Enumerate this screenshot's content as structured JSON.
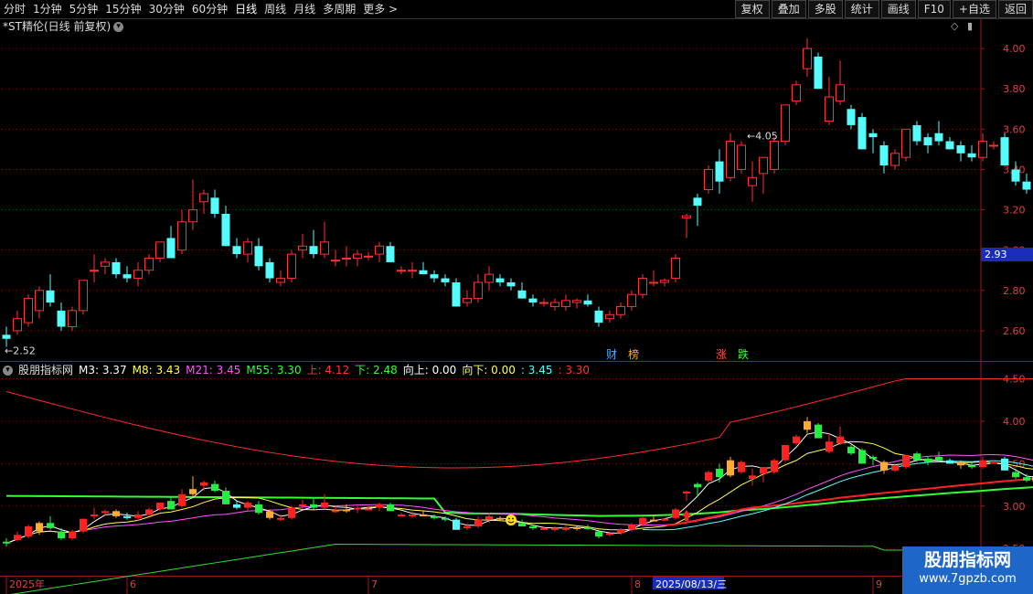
{
  "toolbar": {
    "periods": [
      "分时",
      "1分钟",
      "5分钟",
      "15分钟",
      "30分钟",
      "60分钟",
      "日线",
      "周线",
      "月线",
      "多周期",
      "更多 >"
    ],
    "active_period": "日线",
    "buttons": [
      "复权",
      "叠加",
      "多股",
      "统计",
      "画线",
      "F10",
      "+自选",
      "返回"
    ]
  },
  "stock_title": "*ST精伦(日线 前复权)",
  "current_price_tag": "2.93",
  "indicator": {
    "name": "股朋指标网",
    "items": [
      {
        "label": "M3: 3.37",
        "color": "#ffffff"
      },
      {
        "label": "M8: 3.43",
        "color": "#ffff55"
      },
      {
        "label": "M21: 3.45",
        "color": "#ff55ff"
      },
      {
        "label": "M55: 3.30",
        "color": "#33ff33"
      },
      {
        "label": "上: 4.12",
        "color": "#ff3333"
      },
      {
        "label": "下: 2.48",
        "color": "#33ff33"
      },
      {
        "label": "向上: 0.00",
        "color": "#ffffff"
      },
      {
        "label": "向下: 0.00",
        "color": "#ffff55"
      },
      {
        "label": ": 3.45",
        "color": "#55ffff"
      },
      {
        "label": ": 3.30",
        "color": "#ff3333"
      }
    ]
  },
  "watermark": {
    "line1": "股朋指标网",
    "line2": "www.7gpzb.com"
  },
  "colors": {
    "up": "#ff3333",
    "down": "#54fcfc",
    "background": "#000000",
    "grid": "#7a1010",
    "axis": "#a01818"
  },
  "markers": [
    {
      "text": "财",
      "color": "#55aaff",
      "index": 55
    },
    {
      "text": "榜",
      "color": "#ffaa33",
      "index": 57
    },
    {
      "text": "涨",
      "color": "#ff5555",
      "index": 65
    },
    {
      "text": "跌",
      "color": "#33ff33",
      "index": 67
    }
  ],
  "chart_data": [
    {
      "type": "candlestick",
      "title": "*ST精伦(日线 前复权)",
      "ylim": [
        2.45,
        4.15
      ],
      "yticks": [
        2.6,
        2.8,
        3.0,
        3.2,
        3.4,
        3.6,
        3.8,
        4.0
      ],
      "annotations": [
        {
          "text": "2.52",
          "type": "low",
          "index": 0
        },
        {
          "text": "4.05",
          "type": "high",
          "index": 67
        }
      ],
      "ohlc": [
        [
          2.58,
          2.62,
          2.52,
          2.56
        ],
        [
          2.6,
          2.7,
          2.58,
          2.66
        ],
        [
          2.64,
          2.78,
          2.62,
          2.76
        ],
        [
          2.7,
          2.82,
          2.66,
          2.8
        ],
        [
          2.8,
          2.88,
          2.72,
          2.74
        ],
        [
          2.7,
          2.74,
          2.6,
          2.62
        ],
        [
          2.62,
          2.72,
          2.6,
          2.7
        ],
        [
          2.7,
          2.85,
          2.68,
          2.85
        ],
        [
          2.9,
          2.98,
          2.84,
          2.9
        ],
        [
          2.92,
          2.96,
          2.88,
          2.94
        ],
        [
          2.94,
          2.96,
          2.86,
          2.88
        ],
        [
          2.88,
          2.92,
          2.84,
          2.86
        ],
        [
          2.86,
          2.94,
          2.82,
          2.9
        ],
        [
          2.9,
          2.98,
          2.88,
          2.96
        ],
        [
          2.96,
          3.04,
          2.94,
          3.04
        ],
        [
          3.06,
          3.12,
          2.96,
          2.96
        ],
        [
          3.0,
          3.2,
          2.98,
          3.14
        ],
        [
          3.14,
          3.35,
          3.1,
          3.2
        ],
        [
          3.24,
          3.3,
          3.18,
          3.28
        ],
        [
          3.26,
          3.3,
          3.16,
          3.18
        ],
        [
          3.18,
          3.22,
          3.02,
          3.02
        ],
        [
          3.02,
          3.06,
          2.96,
          2.98
        ],
        [
          2.98,
          3.06,
          2.94,
          3.04
        ],
        [
          3.02,
          3.06,
          2.9,
          2.92
        ],
        [
          2.94,
          2.96,
          2.84,
          2.86
        ],
        [
          2.84,
          2.9,
          2.82,
          2.86
        ],
        [
          2.86,
          3.0,
          2.84,
          2.98
        ],
        [
          3.0,
          3.08,
          2.96,
          3.02
        ],
        [
          3.02,
          3.1,
          2.96,
          2.98
        ],
        [
          2.98,
          3.14,
          2.96,
          3.04
        ],
        [
          2.95,
          3.0,
          2.92,
          2.95
        ],
        [
          2.96,
          3.02,
          2.92,
          2.96
        ],
        [
          2.96,
          3.0,
          2.92,
          2.98
        ],
        [
          2.97,
          2.99,
          2.95,
          2.97
        ],
        [
          2.98,
          3.04,
          2.94,
          3.02
        ],
        [
          3.02,
          3.04,
          2.94,
          2.94
        ],
        [
          2.9,
          2.92,
          2.88,
          2.9
        ],
        [
          2.9,
          2.94,
          2.86,
          2.9
        ],
        [
          2.9,
          2.94,
          2.88,
          2.88
        ],
        [
          2.88,
          2.9,
          2.84,
          2.86
        ],
        [
          2.86,
          2.88,
          2.82,
          2.84
        ],
        [
          2.84,
          2.86,
          2.72,
          2.72
        ],
        [
          2.74,
          2.8,
          2.72,
          2.76
        ],
        [
          2.76,
          2.88,
          2.74,
          2.84
        ],
        [
          2.84,
          2.92,
          2.8,
          2.88
        ],
        [
          2.86,
          2.88,
          2.82,
          2.84
        ],
        [
          2.84,
          2.86,
          2.8,
          2.82
        ],
        [
          2.8,
          2.84,
          2.76,
          2.76
        ],
        [
          2.76,
          2.78,
          2.72,
          2.74
        ],
        [
          2.74,
          2.76,
          2.72,
          2.74
        ],
        [
          2.72,
          2.76,
          2.7,
          2.74
        ],
        [
          2.72,
          2.78,
          2.7,
          2.75
        ],
        [
          2.74,
          2.76,
          2.71,
          2.75
        ],
        [
          2.75,
          2.78,
          2.72,
          2.73
        ],
        [
          2.7,
          2.72,
          2.62,
          2.64
        ],
        [
          2.66,
          2.7,
          2.64,
          2.68
        ],
        [
          2.68,
          2.74,
          2.66,
          2.72
        ],
        [
          2.72,
          2.8,
          2.7,
          2.78
        ],
        [
          2.78,
          2.88,
          2.76,
          2.86
        ],
        [
          2.84,
          2.9,
          2.82,
          2.84
        ],
        [
          2.84,
          2.86,
          2.82,
          2.85
        ],
        [
          2.86,
          2.98,
          2.84,
          2.96
        ],
        [
          3.16,
          3.18,
          3.06,
          3.17
        ],
        [
          3.26,
          3.28,
          3.12,
          3.22
        ],
        [
          3.3,
          3.42,
          3.28,
          3.4
        ],
        [
          3.44,
          3.5,
          3.28,
          3.34
        ],
        [
          3.36,
          3.58,
          3.34,
          3.54
        ],
        [
          3.4,
          3.54,
          3.38,
          3.52
        ],
        [
          3.32,
          3.44,
          3.24,
          3.36
        ],
        [
          3.38,
          3.44,
          3.28,
          3.46
        ],
        [
          3.4,
          3.56,
          3.38,
          3.54
        ],
        [
          3.54,
          3.72,
          3.52,
          3.72
        ],
        [
          3.74,
          3.84,
          3.72,
          3.82
        ],
        [
          3.9,
          4.05,
          3.86,
          4.0
        ],
        [
          3.96,
          3.98,
          3.8,
          3.8
        ],
        [
          3.64,
          3.86,
          3.62,
          3.76
        ],
        [
          3.74,
          3.94,
          3.72,
          3.82
        ],
        [
          3.7,
          3.72,
          3.6,
          3.62
        ],
        [
          3.66,
          3.68,
          3.5,
          3.5
        ],
        [
          3.58,
          3.6,
          3.48,
          3.56
        ],
        [
          3.52,
          3.54,
          3.38,
          3.42
        ],
        [
          3.42,
          3.5,
          3.4,
          3.48
        ],
        [
          3.46,
          3.6,
          3.44,
          3.6
        ],
        [
          3.62,
          3.64,
          3.52,
          3.54
        ],
        [
          3.56,
          3.58,
          3.48,
          3.52
        ],
        [
          3.58,
          3.64,
          3.52,
          3.54
        ],
        [
          3.54,
          3.56,
          3.5,
          3.5
        ],
        [
          3.52,
          3.54,
          3.44,
          3.48
        ],
        [
          3.48,
          3.52,
          3.44,
          3.46
        ],
        [
          3.46,
          3.58,
          3.44,
          3.54
        ],
        [
          3.52,
          3.54,
          3.5,
          3.52
        ],
        [
          3.56,
          3.58,
          3.42,
          3.42
        ],
        [
          3.4,
          3.44,
          3.32,
          3.34
        ],
        [
          3.34,
          3.38,
          3.28,
          3.3
        ],
        [
          3.3,
          3.38,
          3.28,
          3.38
        ]
      ]
    },
    {
      "type": "line",
      "title": "股朋指标网",
      "ylim": [
        2.2,
        4.7
      ],
      "yticks": [
        2.5,
        3.0,
        3.5,
        4.0,
        4.5
      ],
      "series": [
        {
          "name": "M55",
          "color": "#33ff33",
          "start": 3.15,
          "end": 3.3
        },
        {
          "name": "上",
          "color": "#ff3333",
          "start": 4.12,
          "end": 4.12
        },
        {
          "name": "下",
          "color": "#33ff33",
          "start": 2.48,
          "end": 2.48
        }
      ],
      "signals": [
        {
          "type": "smile",
          "index": 46
        },
        {
          "type": "smile",
          "index": 94
        },
        {
          "type": "arrow-up",
          "index": 62
        }
      ]
    }
  ],
  "xaxis": {
    "labels": [
      {
        "text": "2025年",
        "index": 0
      },
      {
        "text": "6",
        "index": 11
      },
      {
        "text": "7",
        "index": 33
      },
      {
        "text": "8",
        "index": 57
      },
      {
        "text": "2025/08/13/三",
        "index": 66,
        "highlight": true
      },
      {
        "text": "9",
        "index": 79
      }
    ]
  }
}
